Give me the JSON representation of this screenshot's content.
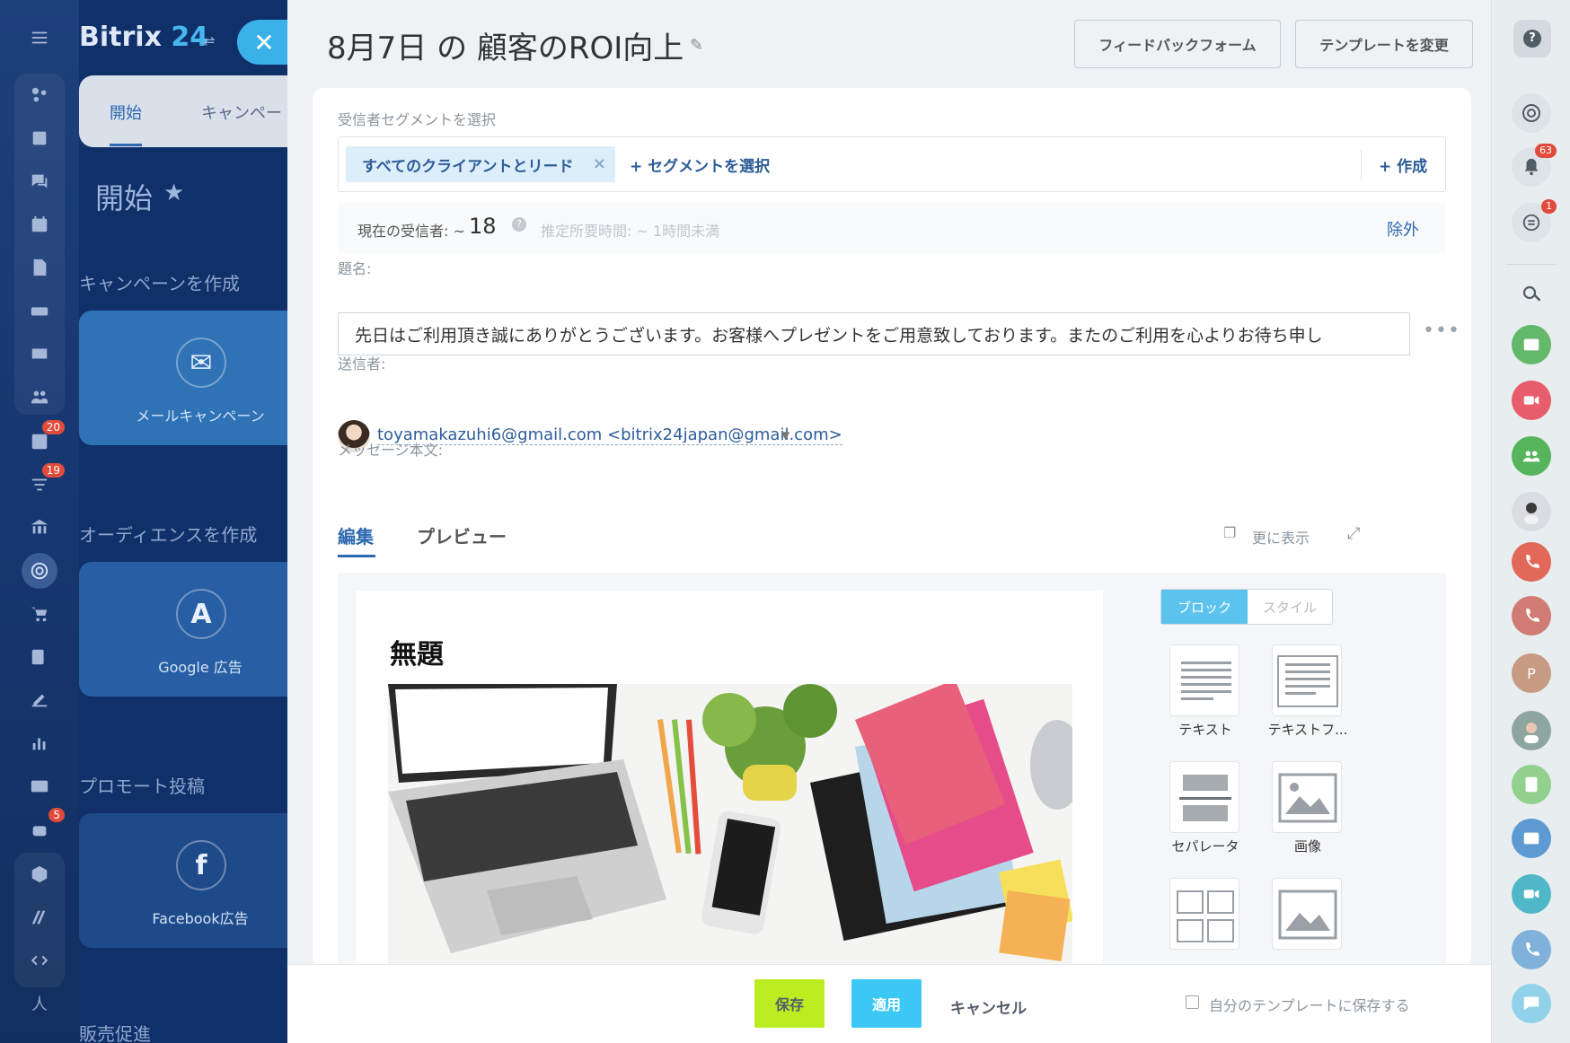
{
  "left_rail": {
    "badges": {
      "tasks": "20",
      "filter": "19",
      "robot": "5"
    },
    "bottom_label": "人"
  },
  "bx": {
    "logo_text": "Bitrix",
    "logo_num": "24",
    "tabs": [
      "開始",
      "キャンペー"
    ],
    "heading": "開始",
    "sections": {
      "create_campaign": "キャンペーンを作成",
      "create_audience": "オーディエンスを作成",
      "promote_post": "プロモート投稿",
      "sales_promo": "販売促進"
    },
    "cards": {
      "email": "メールキャンペーン",
      "google": "Google 広告",
      "facebook": "Facebook広告"
    }
  },
  "slider": {
    "title": "8月7日 の 顧客のROI向上",
    "btn_feedback": "フィードバックフォーム",
    "btn_template": "テンプレートを変更",
    "segment_label": "受信者セグメントを選択",
    "segment_chip": "すべてのクライアントとリード",
    "segment_select": "+ セグメントを選択",
    "segment_create": "+ 作成",
    "recipients_label": "現在の受信者: ~",
    "recipients_count": "18",
    "recipients_estimate": "推定所要時間: ~ 1時間未満",
    "recipients_exclude": "除外",
    "subject_label": "題名:",
    "subject_value": "先日はご利用頂き誠にありがとうございます。お客様へプレゼントをご用意致しております。またのご利用を心よりお待ち申し",
    "sender_label": "送信者:",
    "sender_value": "toyamakazuhi6@gmail.com <bitrix24japan@gmail.com>",
    "message_label": "メッセージ本文:",
    "tab_edit": "編集",
    "tab_preview": "プレビュー",
    "show_more": "更に表示",
    "canvas_title": "無題",
    "block_tab_block": "ブロック",
    "block_tab_style": "スタイル",
    "blocks": [
      "テキスト",
      "テキストフ...",
      "セパレータ",
      "画像"
    ],
    "footer": {
      "save": "保存",
      "apply": "適用",
      "cancel": "キャンセル",
      "save_template": "自分のテンプレートに保存する"
    }
  },
  "right_rail": {
    "notifications_badge": "63",
    "chat_badge": "1",
    "avatar_letter": "P"
  },
  "colors": {
    "accent_blue": "#2d68b1",
    "save_green": "#bbed21",
    "apply_blue": "#3bc8f5",
    "badge_red": "#e04b3c"
  }
}
